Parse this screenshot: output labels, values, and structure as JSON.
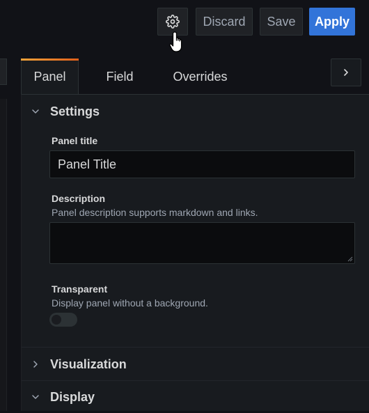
{
  "toolbar": {
    "settings_icon": "gear-icon",
    "discard_label": "Discard",
    "save_label": "Save",
    "apply_label": "Apply"
  },
  "tabs": [
    {
      "label": "Panel",
      "active": true
    },
    {
      "label": "Field",
      "active": false
    },
    {
      "label": "Overrides",
      "active": false
    }
  ],
  "tabs_next_icon": "chevron-right-icon",
  "sections": {
    "settings": {
      "title": "Settings",
      "expanded": true,
      "panel_title": {
        "label": "Panel title",
        "value": "Panel Title"
      },
      "description": {
        "label": "Description",
        "hint": "Panel description supports markdown and links.",
        "value": ""
      },
      "transparent": {
        "label": "Transparent",
        "hint": "Display panel without a background.",
        "enabled": false
      }
    },
    "visualization": {
      "title": "Visualization",
      "expanded": false
    },
    "display": {
      "title": "Display",
      "expanded": true
    }
  },
  "colors": {
    "background": "#111217",
    "panel": "#181b1f",
    "primary": "#3274d9",
    "tab_accent": "#f2a33a"
  }
}
